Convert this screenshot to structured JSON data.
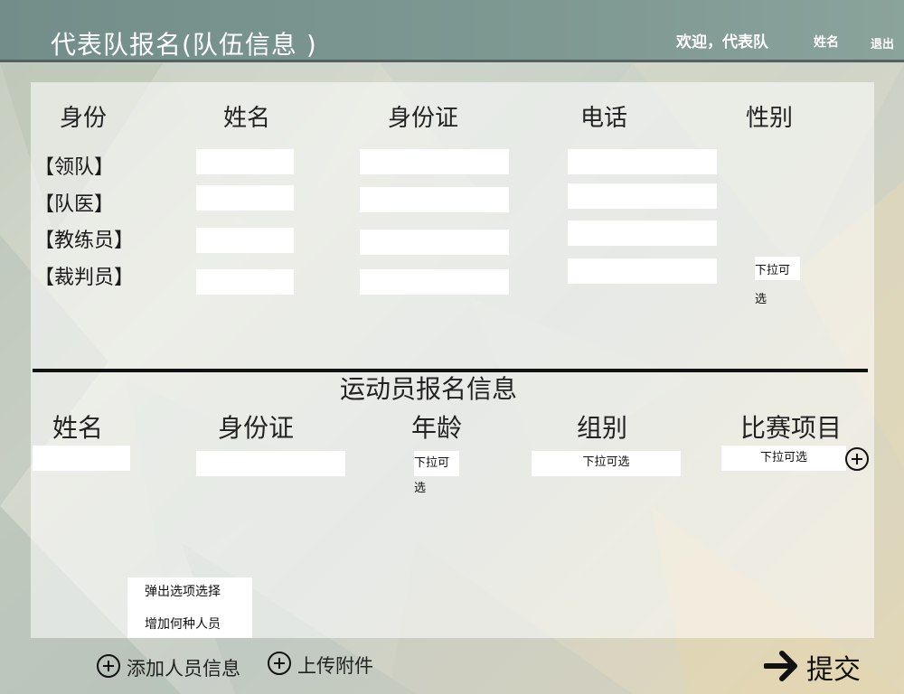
{
  "header": {
    "title": "代表队报名(队伍信息 )",
    "welcome": "欢迎，代表队",
    "user_name": "姓名",
    "logout": "退出"
  },
  "team": {
    "columns": [
      "身份",
      "姓名",
      "身份证",
      "电话",
      "性别"
    ],
    "roles": [
      "【领队】",
      "【队医】",
      "【教练员】",
      "【裁判员】"
    ],
    "gender_select": "下拉可选"
  },
  "athletes": {
    "title": "运动员报名信息",
    "columns": [
      "姓名",
      "身份证",
      "年龄",
      "组别",
      "比赛项目"
    ],
    "age_select": "下拉可选",
    "group_select": "下拉可选",
    "event_select": "下拉可选"
  },
  "popup": {
    "option_1": "弹出选项选择",
    "option_2": "增加何种人员"
  },
  "actions": {
    "add_person": "添加人员信息",
    "upload": "上传附件",
    "submit": "提交"
  },
  "colors": {
    "header_bg": "#7e9892",
    "header_border": "#55615e",
    "text": "#222222"
  }
}
